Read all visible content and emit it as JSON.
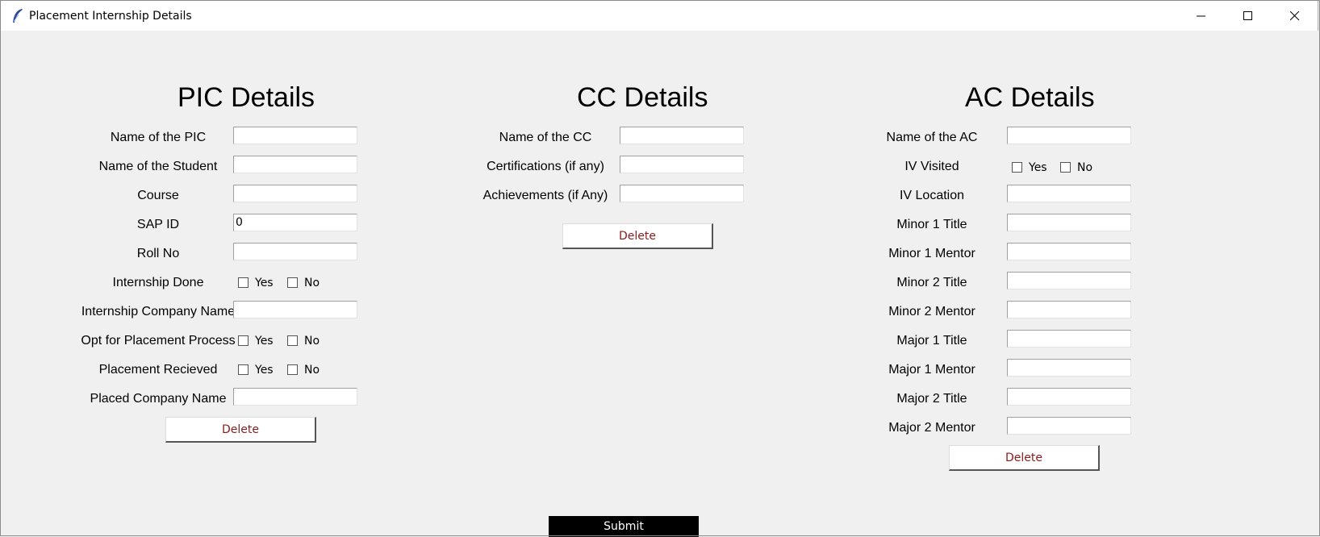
{
  "window": {
    "title": "Placement Internship Details",
    "icons": [
      "feather-icon",
      "minimize-icon",
      "maximize-icon",
      "close-icon"
    ]
  },
  "pic": {
    "title": "PIC Details",
    "name_pic": "Name of the PIC",
    "name_student": "Name of the Student",
    "course": "Course",
    "sap_id": "SAP ID",
    "sap_id_value": "0",
    "roll_no": "Roll No",
    "internship_done": "Internship Done",
    "internship_company": "Internship Company Name",
    "opt_placement": "Opt for Placement Process",
    "placement_received": "Placement Recieved",
    "placed_company": "Placed Company Name",
    "yes": "Yes",
    "no": "No",
    "delete": "Delete"
  },
  "cc": {
    "title": "CC Details",
    "name_cc": "Name of the CC",
    "certifications": "Certifications (if any)",
    "achievements": "Achievements (if Any)",
    "delete": "Delete"
  },
  "ac": {
    "title": "AC Details",
    "name_ac": "Name of the AC",
    "iv_visited": "IV Visited",
    "yes": "Yes",
    "no": "No",
    "iv_location": "IV Location",
    "minor1_title": "Minor 1 Title",
    "minor1_mentor": "Minor 1 Mentor",
    "minor2_title": "Minor 2 Title",
    "minor2_mentor": "Minor 2 Mentor",
    "major1_title": "Major 1 Title",
    "major1_mentor": "Major 1 Mentor",
    "major2_title": "Major 2 Title",
    "major2_mentor": "Major 2 Mentor",
    "delete": "Delete"
  },
  "submit": "Submit",
  "colors": {
    "background": "#f0f0f0",
    "delete_text": "#8b1a1a",
    "submit_bg": "#000000",
    "submit_text": "#ffffff"
  }
}
